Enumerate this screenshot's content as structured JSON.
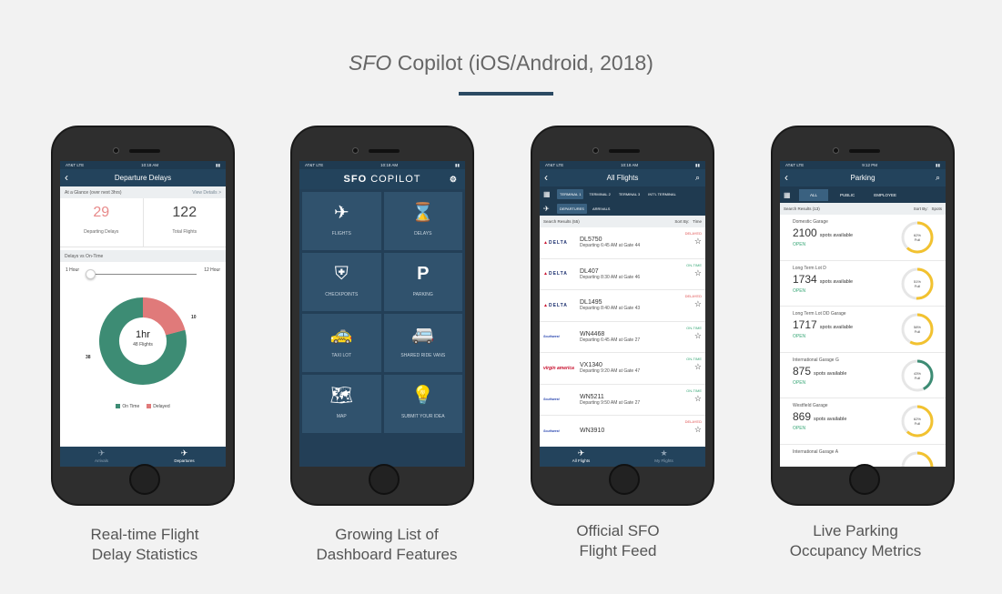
{
  "page": {
    "title_italic": "SFO",
    "title_rest": " Copilot (iOS/Android, 2018)",
    "accent_color": "#2b4a63"
  },
  "captions": [
    [
      "Real-time Flight",
      "Delay Statistics"
    ],
    [
      "Growing List of",
      "Dashboard Features"
    ],
    [
      "Official SFO",
      "Flight Feed"
    ],
    [
      "Live Parking",
      "Occupancy Metrics"
    ]
  ],
  "status": {
    "carrier": "AT&T  LTE",
    "time": "10:18 AM",
    "time_parking": "9:12 PM",
    "carrier_parking": "AT&T  LTE"
  },
  "delays": {
    "nav_title": "Departure Delays",
    "glance_label": "At a Glance (over next 3hrs)",
    "view_details": "View Details >",
    "departing_delays": "29",
    "departing_delays_label": "Departing Delays",
    "total_flights": "122",
    "total_flights_label": "Total Flights",
    "section_label": "Delays vs On-Time",
    "slider_min": "1 Hour",
    "slider_max": "12 Hour",
    "slider_value": 0,
    "center_big": "1hr",
    "center_small": "48 Flights",
    "on_time_value": "38",
    "delayed_value": "10",
    "legend_on_time": "On Time",
    "legend_delayed": "Delayed",
    "on_time_color": "#3d8c74",
    "delayed_color": "#e07a7a",
    "tab_arrivals": "Arrivals",
    "tab_departures": "Departures",
    "arrivals_icon": "plane-landing-icon",
    "departures_icon": "plane-takeoff-icon"
  },
  "dashboard": {
    "brand_bold": "SFO",
    "brand_light": " COPILOT",
    "tiles": [
      {
        "label": "FLIGHTS",
        "icon": "plane-icon",
        "glyph": "✈"
      },
      {
        "label": "DELAYS",
        "icon": "hourglass-icon",
        "glyph": "⌛"
      },
      {
        "label": "CHECKPOINTS",
        "icon": "checkpoint-icon",
        "glyph": "⛨"
      },
      {
        "label": "PARKING",
        "icon": "parking-icon",
        "glyph": "P"
      },
      {
        "label": "TAXI LOT",
        "icon": "taxi-icon",
        "glyph": "🚕"
      },
      {
        "label": "SHARED RIDE VANS",
        "icon": "van-icon",
        "glyph": "🚐"
      },
      {
        "label": "MAP",
        "icon": "map-icon",
        "glyph": "🗺"
      },
      {
        "label": "SUBMIT YOUR IDEA",
        "icon": "lightbulb-icon",
        "glyph": "💡"
      }
    ]
  },
  "flights": {
    "nav_title": "All Flights",
    "terminals": [
      "TERMINAL 1",
      "TERMINAL 2",
      "TERMINAL 3",
      "INT'L TERMINAL"
    ],
    "modes": [
      "DEPARTURES",
      "ARRIVALS"
    ],
    "results_label": "Search Results (55)",
    "sort_label": "Sort By:",
    "sort_value": "Time",
    "rows": [
      {
        "airline": "DELTA",
        "code": "DL5750",
        "detail": "Departing 6:45 AM at Gate 44",
        "status": "DELAYED"
      },
      {
        "airline": "DELTA",
        "code": "DL407",
        "detail": "Departing 8:30 AM at Gate 46",
        "status": "ON-TIME"
      },
      {
        "airline": "DELTA",
        "code": "DL1495",
        "detail": "Departing 8:40 AM at Gate 43",
        "status": "DELAYED"
      },
      {
        "airline": "Southwest",
        "code": "WN4468",
        "detail": "Departing 6:45 AM at Gate 27",
        "status": "ON-TIME"
      },
      {
        "airline": "virgin america",
        "code": "VX1340",
        "detail": "Departing 9:20 AM at Gate 47",
        "status": "ON-TIME"
      },
      {
        "airline": "Southwest",
        "code": "WN5211",
        "detail": "Departing 9:50 AM at Gate 27",
        "status": "ON-TIME"
      },
      {
        "airline": "Southwest",
        "code": "WN3910",
        "detail": "",
        "status": "DELAYED"
      }
    ],
    "tab_all": "All Flights",
    "tab_my": "My Flights"
  },
  "parking": {
    "nav_title": "Parking",
    "filters": [
      "ALL",
      "PUBLIC",
      "EMPLOYEE"
    ],
    "results_label": "Search Results (13)",
    "sort_label": "Sort By:",
    "sort_value": "Spots",
    "spots_unit": "spots available",
    "rows": [
      {
        "name": "Domestic Garage",
        "spots": "2100",
        "status": "OPEN",
        "full_pct": 62,
        "full_label": "62%",
        "color": "#f2c230"
      },
      {
        "name": "Long Term Lot D",
        "spots": "1734",
        "status": "OPEN",
        "full_pct": 51,
        "full_label": "51%",
        "color": "#f2c230"
      },
      {
        "name": "Long Term Lot DD Garage",
        "spots": "1717",
        "status": "OPEN",
        "full_pct": 58,
        "full_label": "58%",
        "color": "#f2c230"
      },
      {
        "name": "International Garage G",
        "spots": "875",
        "status": "OPEN",
        "full_pct": 43,
        "full_label": "43%",
        "color": "#3d8c74"
      },
      {
        "name": "Westfield Garage",
        "spots": "869",
        "status": "OPEN",
        "full_pct": 62,
        "full_label": "62%",
        "color": "#f2c230"
      },
      {
        "name": "International Garage A",
        "spots": "",
        "status": "",
        "full_pct": 55,
        "full_label": "",
        "color": "#f2c230"
      }
    ],
    "full_word": "Full"
  }
}
